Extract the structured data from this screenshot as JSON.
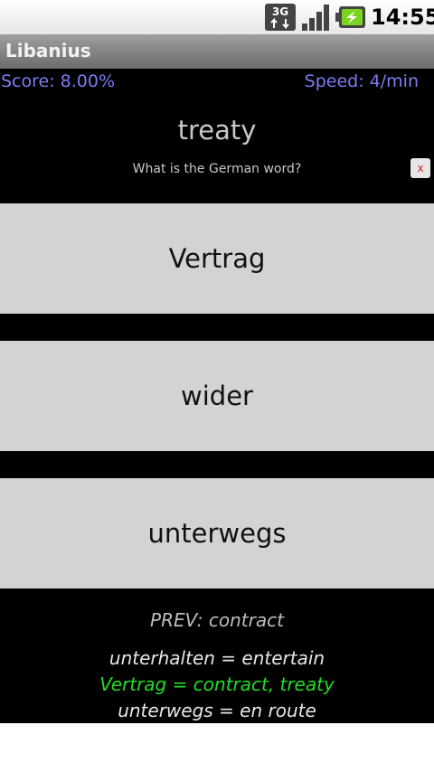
{
  "status_bar": {
    "network": "3G",
    "time": "14:55",
    "icons": [
      "3g-data-icon",
      "signal-strength-icon",
      "battery-charging-icon"
    ]
  },
  "app": {
    "title": "Libanius"
  },
  "quiz": {
    "score": "Score: 8.00%",
    "speed": "Speed: 4/min",
    "question_word": "treaty",
    "prompt": "What is the German word?",
    "close_label": "x",
    "answers": [
      "Vertrag",
      "wider",
      "unterwegs"
    ],
    "previous": "PREV: contract",
    "history": [
      "unterhalten = entertain",
      "Vertrag = contract, treaty",
      "unterwegs = en route"
    ]
  },
  "colors": {
    "accent_blue": "#7c7cf2",
    "correct_green": "#22dd22",
    "button_gray": "#d3d3d3",
    "close_red": "#d21e1e"
  }
}
